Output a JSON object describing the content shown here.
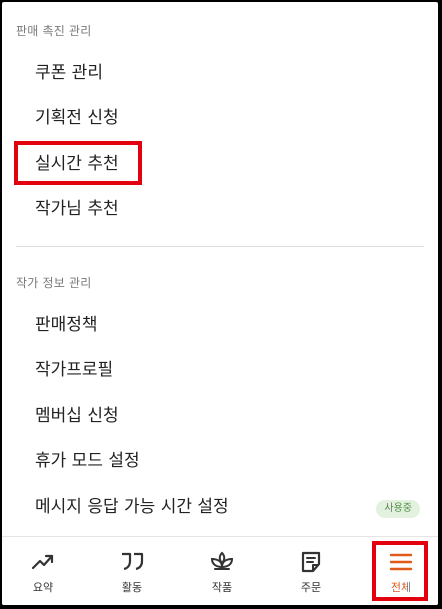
{
  "sections": [
    {
      "title": "판매 촉진 관리",
      "items": [
        "쿠폰 관리",
        "기획전 신청",
        "실시간 추천",
        "작가님 추천"
      ]
    },
    {
      "title": "작가 정보 관리",
      "items": [
        "판매정책",
        "작가프로필",
        "멤버십 신청",
        "휴가 모드 설정",
        "메시지 응답 가능 시간 설정"
      ]
    }
  ],
  "badge": "사용중",
  "nav": [
    {
      "label": "요약",
      "icon": "trend-icon"
    },
    {
      "label": "활동",
      "icon": "quote-icon"
    },
    {
      "label": "작품",
      "icon": "plant-icon"
    },
    {
      "label": "주문",
      "icon": "order-icon"
    },
    {
      "label": "전체",
      "icon": "menu-icon"
    }
  ],
  "colors": {
    "highlight": "#e3000f",
    "active": "#e05a1a",
    "badge_bg": "#e3f1df",
    "badge_text": "#4f8f43"
  }
}
